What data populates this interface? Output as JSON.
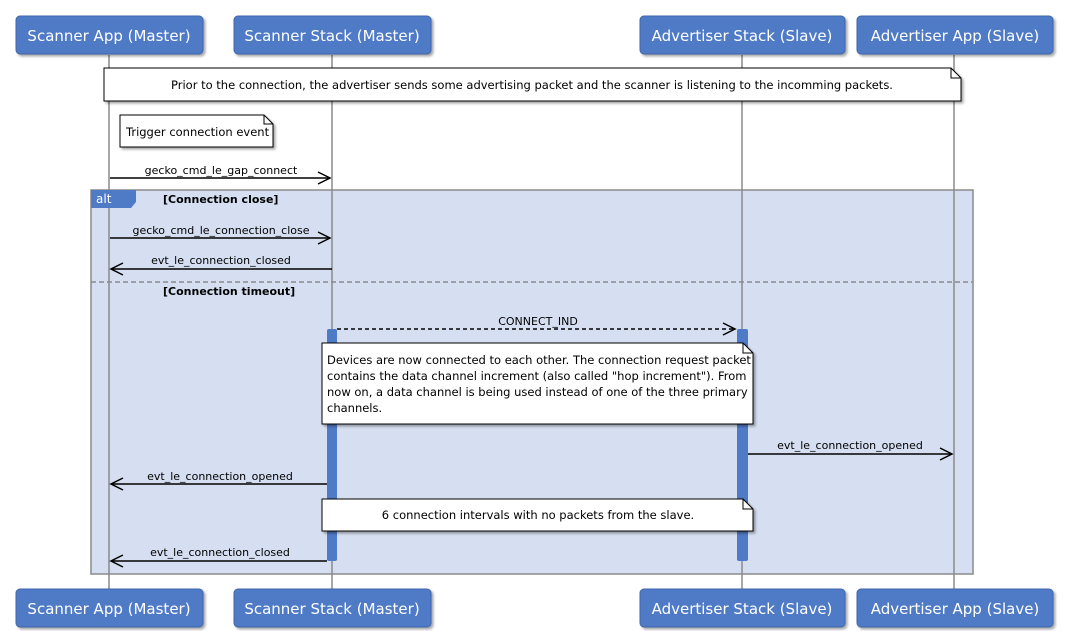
{
  "participants": [
    "Scanner App (Master)",
    "Scanner Stack (Master)",
    "Advertiser Stack (Slave)",
    "Advertiser App (Slave)"
  ],
  "notes": {
    "prior": "Prior to the connection, the advertiser sends some advertising packet and the scanner is listening to the incomming packets.",
    "trigger": "Trigger connection event",
    "connected": [
      "Devices are now connected to each other. The connection request packet",
      "contains the data channel increment (also called \"hop increment\"). From",
      "now on, a data channel is being used instead of one of the three primary",
      "channels."
    ],
    "timeout": "6 connection intervals with no packets from the slave."
  },
  "messages": {
    "gap_connect": "gecko_cmd_le_gap_connect",
    "conn_close": "gecko_cmd_le_connection_close",
    "closed_1": "evt_le_connection_closed",
    "connect_ind": "CONNECT_IND",
    "opened_slave": "evt_le_connection_opened",
    "opened_master": "evt_le_connection_opened",
    "closed_2": "evt_le_connection_closed"
  },
  "alt": {
    "label": "alt",
    "guard_1": "[Connection close]",
    "guard_2": "[Connection timeout]"
  },
  "colors": {
    "participant": "#4f7ac6",
    "fragment_bg": "#d6dff1",
    "activation": "#4f7ac6"
  }
}
